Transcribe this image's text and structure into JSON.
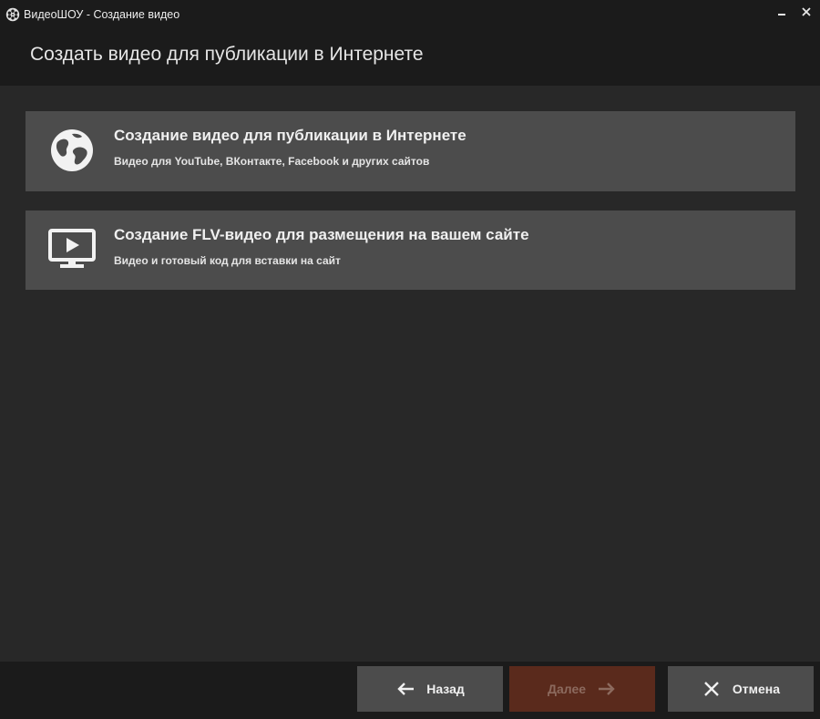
{
  "window": {
    "title": "ВидеоШОУ - Создание видео"
  },
  "header": {
    "title": "Создать видео для публикации в Интернете"
  },
  "options": [
    {
      "title": "Создание видео для публикации в Интернете",
      "subtitle": "Видео для YouTube, ВКонтакте, Facebook и других сайтов",
      "icon": "globe-icon"
    },
    {
      "title": "Создание FLV-видео для размещения на вашем сайте",
      "subtitle": "Видео и готовый код для вставки на сайт",
      "icon": "monitor-play-icon"
    }
  ],
  "footer": {
    "back_label": "Назад",
    "next_label": "Далее",
    "cancel_label": "Отмена"
  },
  "colors": {
    "background": "#1b1b1b",
    "content": "#282828",
    "card": "#4c4c4c",
    "next_disabled": "#5a2a1c"
  }
}
